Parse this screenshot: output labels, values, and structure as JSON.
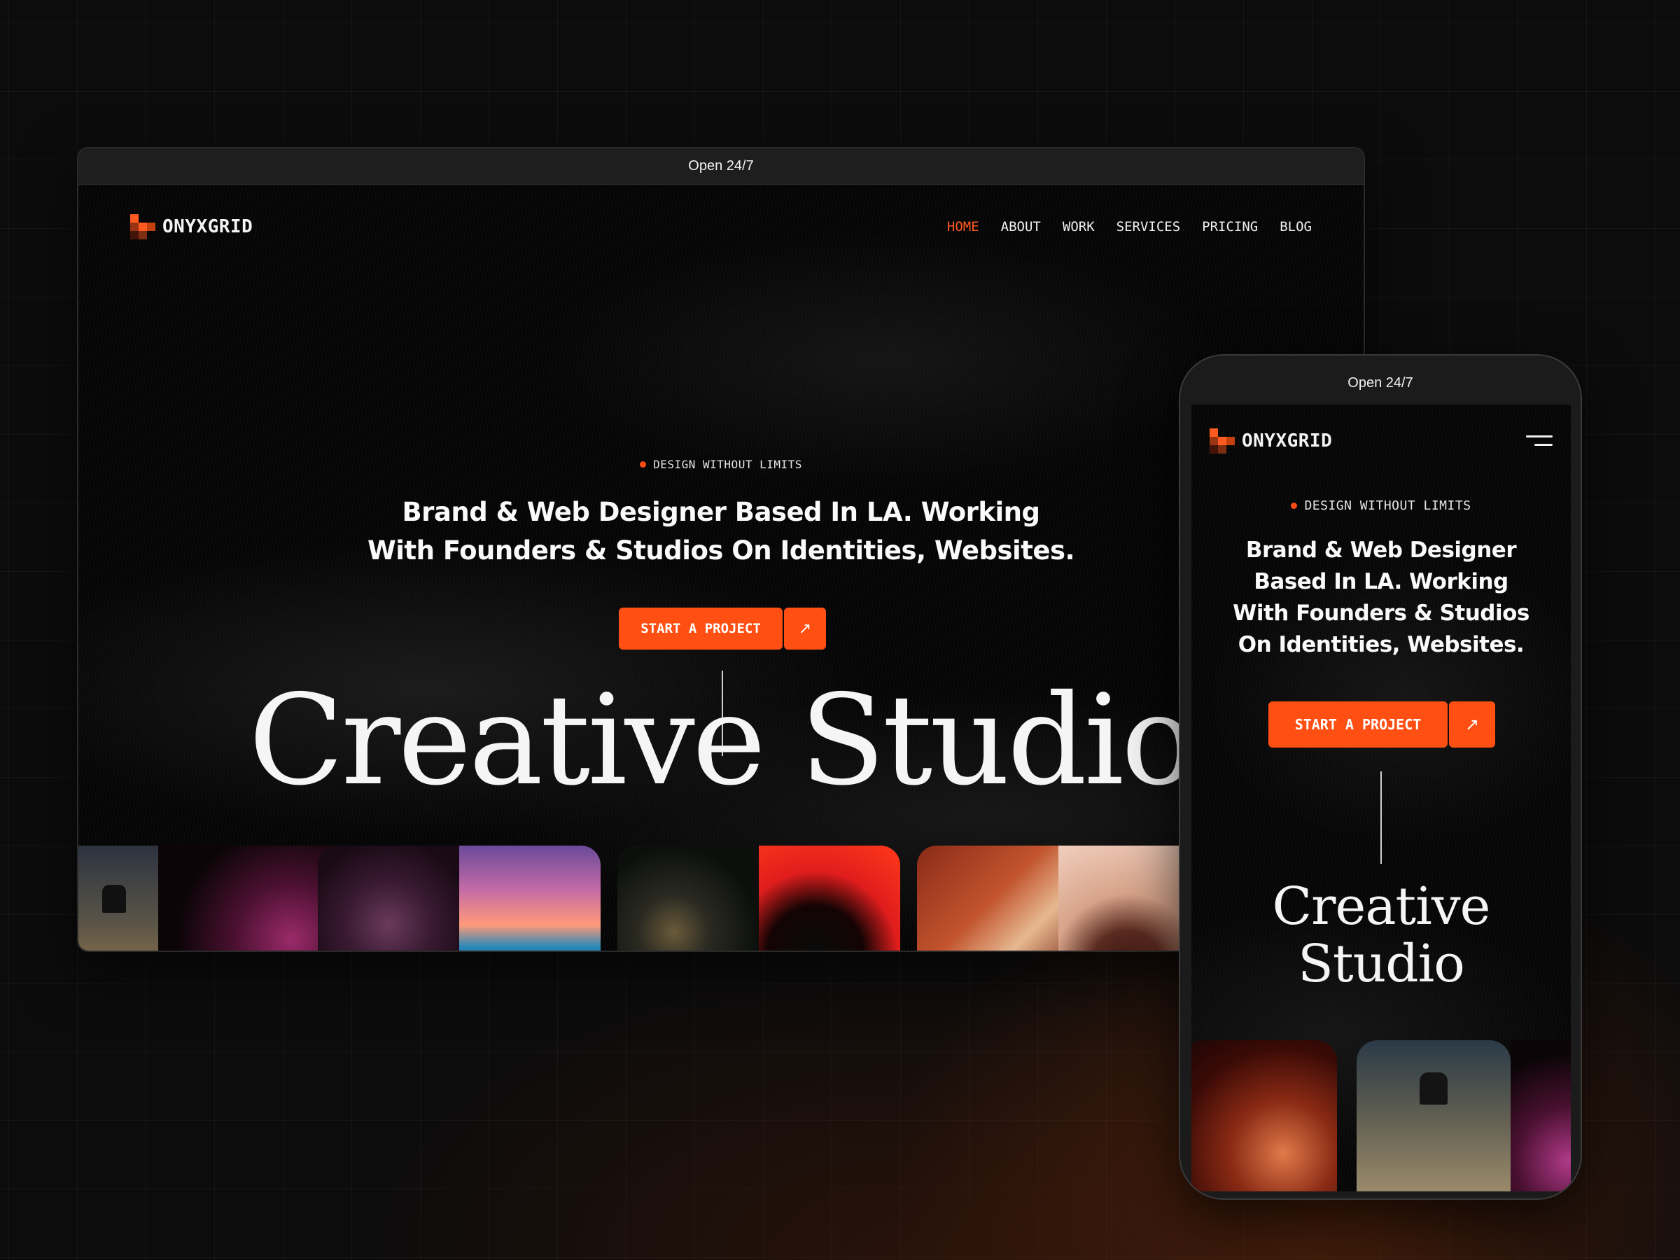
{
  "status_text": "Open 24/7",
  "brand": "ONYXGRID",
  "nav": {
    "items": [
      {
        "label": "HOME",
        "active": true
      },
      {
        "label": "ABOUT",
        "active": false
      },
      {
        "label": "WORK",
        "active": false
      },
      {
        "label": "SERVICES",
        "active": false
      },
      {
        "label": "PRICING",
        "active": false
      },
      {
        "label": "BLOG",
        "active": false
      }
    ]
  },
  "hero": {
    "eyebrow": "DESIGN WITHOUT LIMITS",
    "headline_line1": "Brand & Web Designer Based In LA. Working",
    "headline_line2": "With Founders & Studios On Identities, Websites.",
    "cta_label": "START A PROJECT",
    "cta_arrow": "↗",
    "title": "Creative Studio"
  },
  "mobile": {
    "headline_lines": [
      "Brand & Web Designer",
      "Based In LA. Working",
      "With Founders & Studios",
      "On Identities, Websites."
    ],
    "title_line1": "Creative",
    "title_line2": "Studio",
    "menu_icon": "hamburger-menu-icon"
  },
  "colors": {
    "accent": "#ff4f12",
    "background": "#0d0c0c",
    "text": "#f5f5f5"
  }
}
